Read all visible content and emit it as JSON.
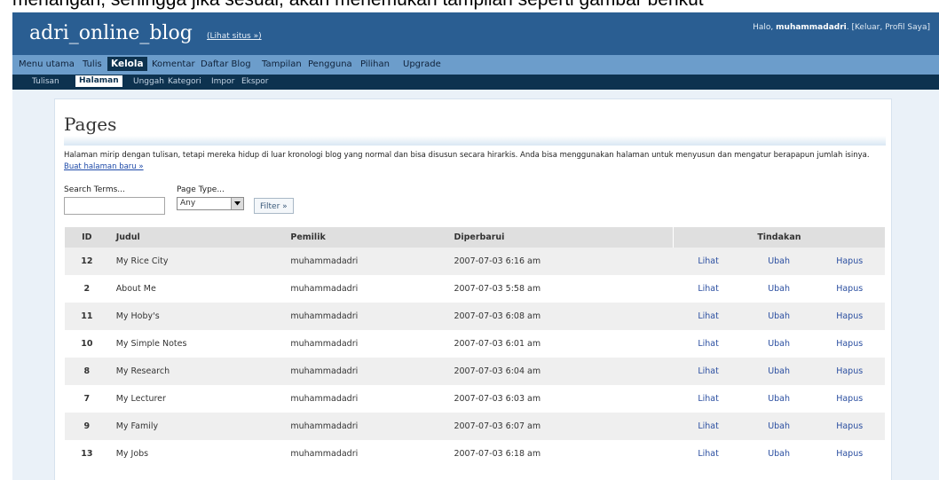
{
  "caption": "menangan, sehingga jika sesuai, akan menemukan tampilan seperti gambar berikut",
  "header": {
    "site_title": "adri_online_blog",
    "view_site": "(Lihat situs »)",
    "greeting": "Halo,",
    "username": "muhammadadri",
    "user_links": ". [Keluar, Profil Saya]"
  },
  "main_nav": [
    "Menu utama",
    "Tulis",
    "Kelola",
    "Komentar",
    "Daftar Blog",
    "Tampilan",
    "Pengguna",
    "Pilihan",
    "Upgrade"
  ],
  "main_nav_active": "Kelola",
  "sub_nav": [
    "Tulisan",
    "Halaman",
    "Unggah",
    "Kategori",
    "Impor",
    "Ekspor"
  ],
  "sub_nav_active": "Halaman",
  "page": {
    "title": "Pages",
    "intro": "Halaman mirip dengan tulisan, tetapi mereka hidup di luar kronologi blog yang normal dan bisa disusun secara hirarkis. Anda bisa menggunakan halaman untuk menyusun dan mengatur berapapun jumlah isinya.",
    "new_page_link": "Buat halaman baru »"
  },
  "filters": {
    "search_label": "Search Terms...",
    "search_value": "",
    "page_type_label": "Page Type...",
    "page_type_value": "Any",
    "filter_button": "Filter »"
  },
  "table": {
    "headers": {
      "id": "ID",
      "title": "Judul",
      "owner": "Pemilik",
      "updated": "Diperbarui",
      "actions": "Tindakan"
    },
    "action_labels": {
      "view": "Lihat",
      "edit": "Ubah",
      "delete": "Hapus"
    },
    "rows": [
      {
        "id": "12",
        "title": "My Rice City",
        "owner": "muhammadadri",
        "updated": "2007-07-03 6:16 am"
      },
      {
        "id": "2",
        "title": "About Me",
        "owner": "muhammadadri",
        "updated": "2007-07-03 5:58 am"
      },
      {
        "id": "11",
        "title": "My Hoby's",
        "owner": "muhammadadri",
        "updated": "2007-07-03 6:08 am"
      },
      {
        "id": "10",
        "title": "My Simple Notes",
        "owner": "muhammadadri",
        "updated": "2007-07-03 6:01 am"
      },
      {
        "id": "8",
        "title": "My Research",
        "owner": "muhammadadri",
        "updated": "2007-07-03 6:04 am"
      },
      {
        "id": "7",
        "title": "My Lecturer",
        "owner": "muhammadadri",
        "updated": "2007-07-03 6:03 am"
      },
      {
        "id": "9",
        "title": "My Family",
        "owner": "muhammadadri",
        "updated": "2007-07-03 6:07 am"
      },
      {
        "id": "13",
        "title": "My Jobs",
        "owner": "muhammadadri",
        "updated": "2007-07-03 6:18 am"
      }
    ]
  },
  "colors": {
    "header_bg": "#2a5e92",
    "nav_bg": "#6c9dcb",
    "subnav_bg": "#0d324f",
    "link": "#2a4ea0"
  }
}
